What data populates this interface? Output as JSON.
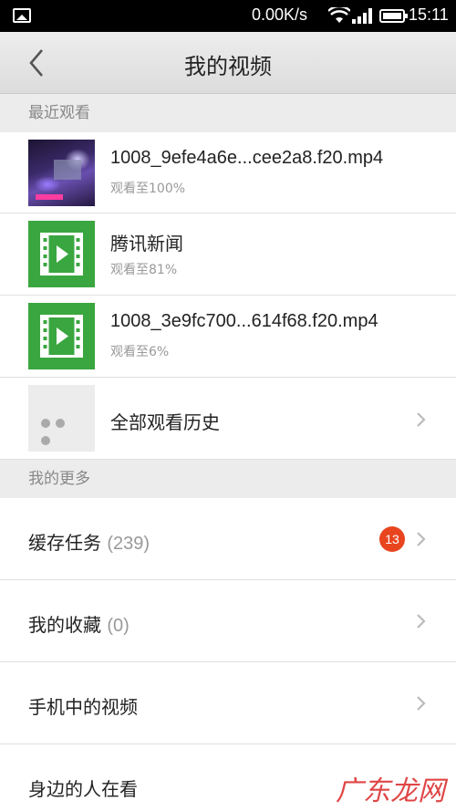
{
  "status_bar": {
    "network_speed": "0.00K/s",
    "time": "15:11"
  },
  "header": {
    "title": "我的视频"
  },
  "recent_section": {
    "header": "最近观看",
    "items": [
      {
        "title": "1008_9efe4a6e...cee2a8.f20.mp4",
        "progress": "观看至100%",
        "thumb": "video-frame"
      },
      {
        "title": "腾讯新闻",
        "progress": "观看至81%",
        "thumb": "film-icon"
      },
      {
        "title": "1008_3e9fc700...614f68.f20.mp4",
        "progress": "观看至6%",
        "thumb": "film-icon"
      }
    ],
    "history_label": "全部观看历史"
  },
  "more_section": {
    "header": "我的更多",
    "items": [
      {
        "label": "缓存任务",
        "count": "(239)",
        "badge": "13"
      },
      {
        "label": "我的收藏",
        "count": "(0)"
      },
      {
        "label": "手机中的视频"
      },
      {
        "label": "身边的人在看"
      }
    ]
  },
  "watermark": {
    "text": "广东龙网"
  },
  "colors": {
    "accent_green": "#3aa63f",
    "badge_red": "#e8451e",
    "section_bg": "#ececec"
  }
}
